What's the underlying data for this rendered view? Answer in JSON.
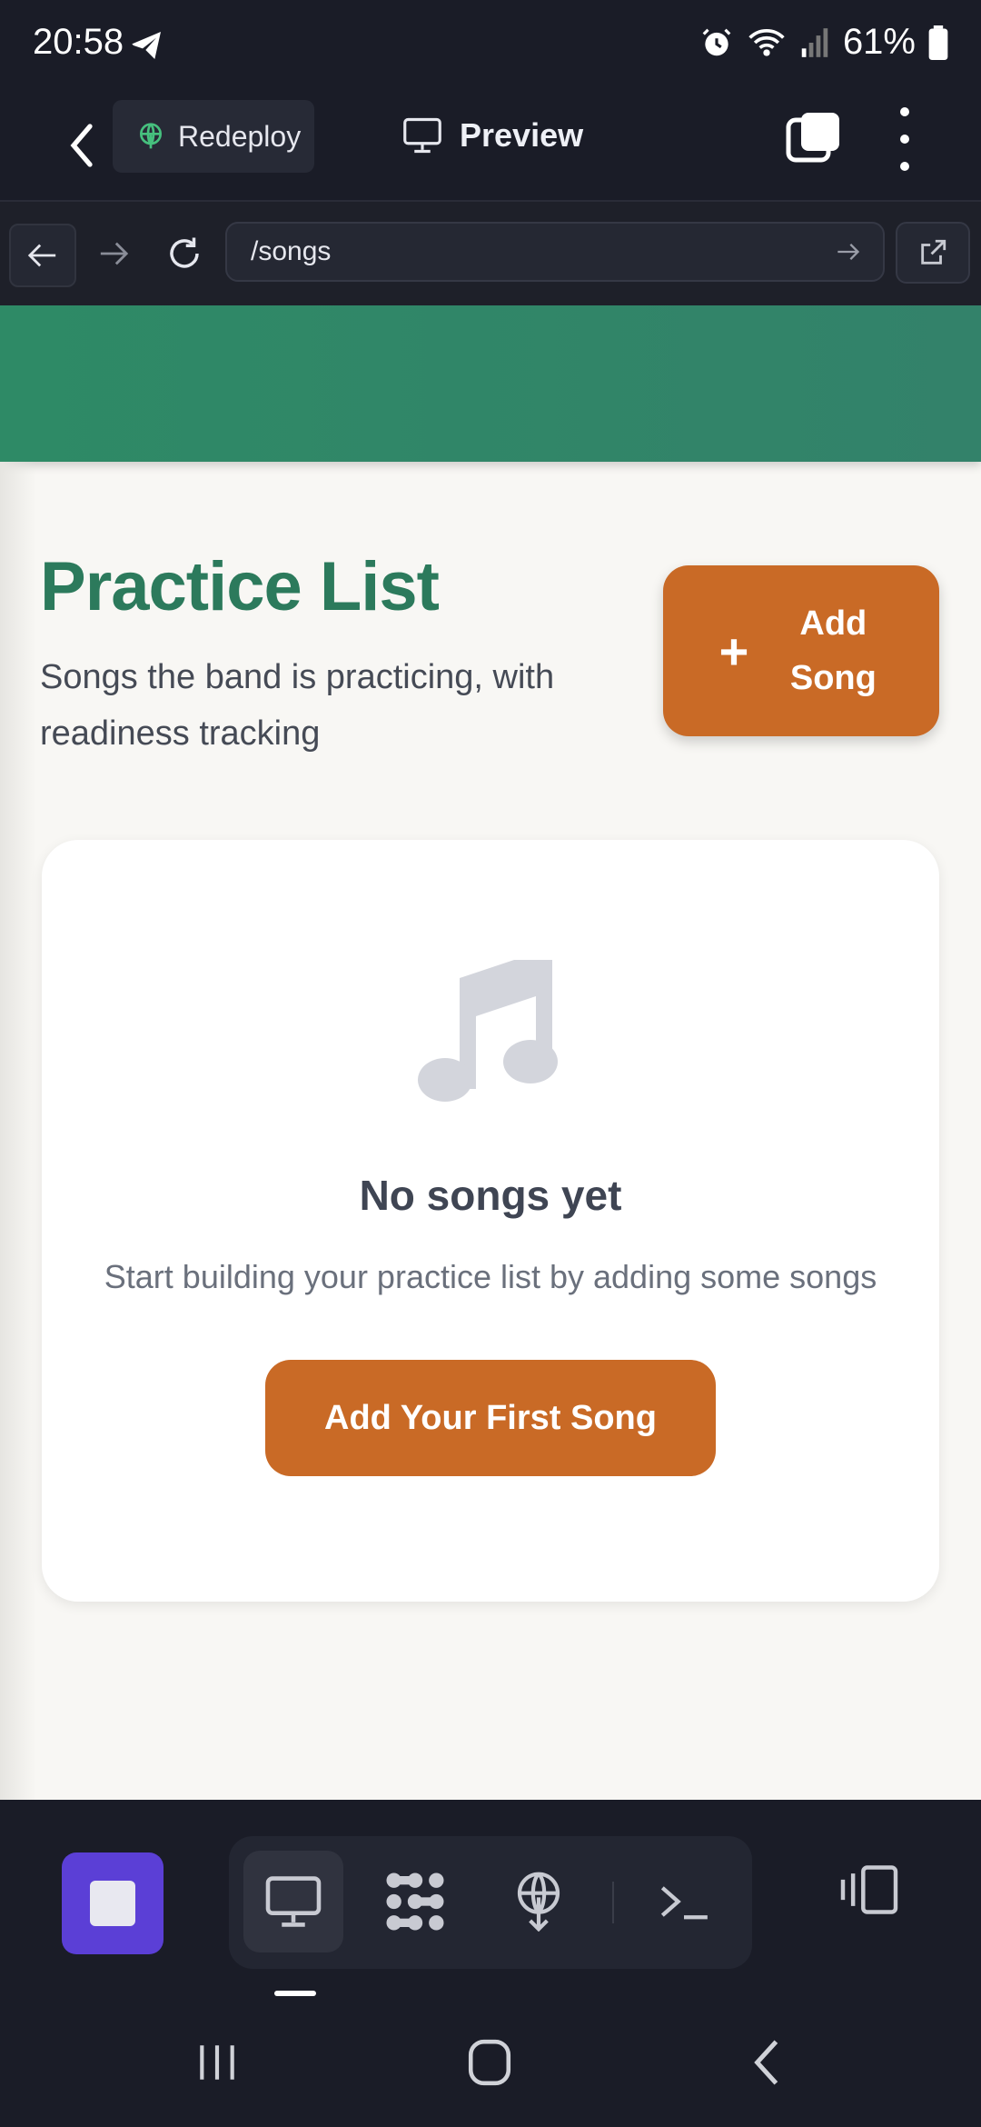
{
  "status_bar": {
    "time": "20:58",
    "battery": "61%",
    "icons": [
      "telegram-icon",
      "alarm-icon",
      "wifi-icon",
      "signal-icon",
      "battery-icon"
    ]
  },
  "header": {
    "redeploy_label": "Redeploy",
    "preview_label": "Preview"
  },
  "browser": {
    "url": "/songs"
  },
  "page": {
    "title": "Practice List",
    "subtitle": "Songs the band is practicing, with readiness tracking",
    "add_button_label": "Add Song",
    "empty_state": {
      "title": "No songs yet",
      "text": "Start building your practice list by adding some songs",
      "button_label": "Add Your First Song"
    }
  },
  "colors": {
    "brand_green": "#2c7a5c",
    "hero_green": "#2e8a66",
    "accent_orange": "#c96a26",
    "stop_purple": "#5b3fd6"
  },
  "toolbar": {
    "items": [
      "preview-icon",
      "nodes-icon",
      "deploy-icon",
      "terminal-icon"
    ],
    "active": "preview-icon"
  }
}
